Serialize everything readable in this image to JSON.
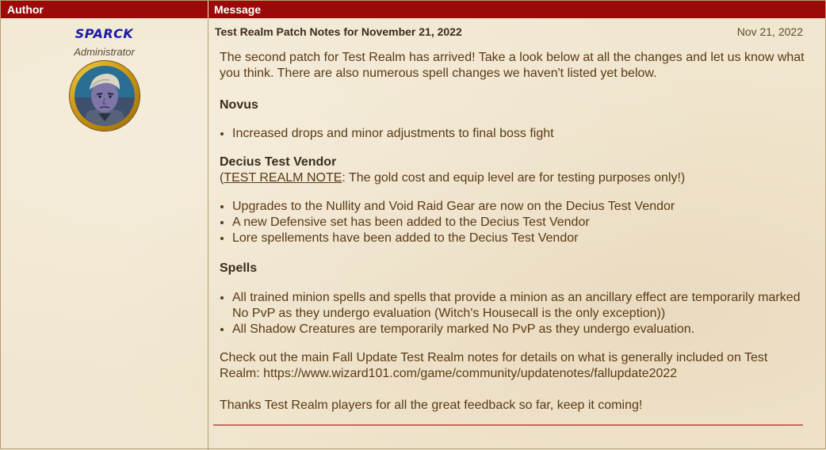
{
  "table": {
    "header_author": "Author",
    "header_message": "Message"
  },
  "author": {
    "name": "SPARCK",
    "role": "Administrator"
  },
  "post": {
    "title": "Test Realm Patch Notes for November 21, 2022",
    "date": "Nov 21, 2022",
    "intro": "The second patch for Test Realm has arrived! Take a look below at all the changes and let us know what you think. There are also numerous spell changes we haven't listed yet below.",
    "sections": [
      {
        "heading": "Novus",
        "items": [
          "Increased drops and minor adjustments to final boss fight"
        ]
      },
      {
        "heading": "Decius Test Vendor",
        "note_open": "(",
        "note_link": "TEST REALM NOTE",
        "note_rest": ": The gold cost and equip level are for testing purposes only!)",
        "items": [
          "Upgrades to the Nullity and Void Raid Gear are now on the Decius Test Vendor",
          "A new Defensive set has been added to the Decius Test Vendor",
          "Lore spellements have been added to the Decius Test Vendor"
        ]
      },
      {
        "heading": "Spells",
        "items": [
          "All trained minion spells and spells that provide a minion as an ancillary effect are temporarily marked No PvP as they undergo evaluation (Witch's Housecall is the only exception))",
          "All Shadow Creatures are temporarily marked No PvP as they undergo evaluation."
        ]
      }
    ],
    "check_out": "Check out the main Fall Update Test Realm notes for details on what is generally included on Test Realm: https://www.wizard101.com/game/community/updatenotes/fallupdate2022",
    "thanks": "Thanks Test Realm players for all the great feedback so far, keep it coming!"
  },
  "colors": {
    "header_bg": "#9b0a08",
    "parchment": "#f1e6cf",
    "author_name": "#1a1aa8",
    "body_text": "#5a3a14"
  },
  "icons": {
    "avatar": "wizard-portrait-avatar"
  }
}
